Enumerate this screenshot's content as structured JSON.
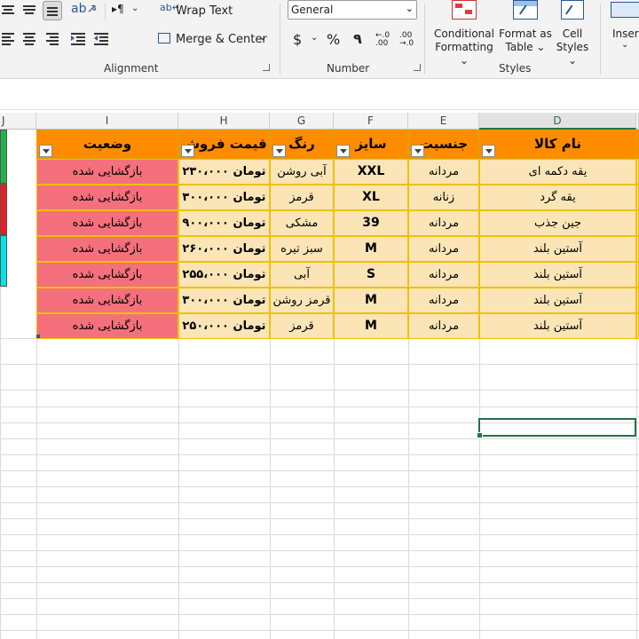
{
  "ribbon": {
    "wrap_text": "Wrap Text",
    "merge_center": "Merge & Center",
    "number_format": "General",
    "currency": "$",
    "percent": "%",
    "comma": "٩",
    "conditional_formatting_l1": "Conditional",
    "conditional_formatting_l2": "Formatting",
    "format_as_table_l1": "Format as",
    "format_as_table_l2": "Table",
    "cell_styles_l1": "Cell",
    "cell_styles_l2": "Styles",
    "insert": "Insert",
    "groups": {
      "alignment": "Alignment",
      "number": "Number",
      "styles": "Styles"
    }
  },
  "columns": [
    "J",
    "I",
    "H",
    "G",
    "F",
    "E",
    "D"
  ],
  "table": {
    "headers": [
      "وضعیت",
      "قیمت فروش",
      "رنگ",
      "سایز",
      "جنسیت",
      "نام کالا"
    ],
    "rows": [
      [
        "بازگشایی شده",
        "۲۳۰،۰۰۰ تومان",
        "آبی روشن",
        "XXL",
        "مردانه",
        "یقه دکمه ای"
      ],
      [
        "بازگشایی شده",
        "۳۰۰،۰۰۰ تومان",
        "قرمز",
        "XL",
        "زنانه",
        "یقه گرد"
      ],
      [
        "بازگشایی شده",
        "۹۰۰،۰۰۰ تومان",
        "مشکی",
        "39",
        "مردانه",
        "جین جذب"
      ],
      [
        "بازگشایی شده",
        "۲۶۰،۰۰۰ تومان",
        "سبز تیره",
        "M",
        "مردانه",
        "آستین بلند"
      ],
      [
        "بازگشایی شده",
        "۲۵۵،۰۰۰ تومان",
        "آبی",
        "S",
        "مردانه",
        "آستین بلند"
      ],
      [
        "بازگشایی شده",
        "۳۰۰،۰۰۰ تومان",
        "قرمز روشن",
        "M",
        "مردانه",
        "آستین بلند"
      ],
      [
        "بازگشایی شده",
        "۲۵۰،۰۰۰ تومان",
        "قرمز",
        "M",
        "مردانه",
        "آستین بلند"
      ]
    ]
  },
  "colors": {
    "header_fill": "#ff8c00",
    "row_fill": "#fbe5b7",
    "status_fill": "#f4707c",
    "legend": [
      "#22b14c",
      "#ed1c24",
      "#00e5e5"
    ],
    "selection": "#217346"
  }
}
